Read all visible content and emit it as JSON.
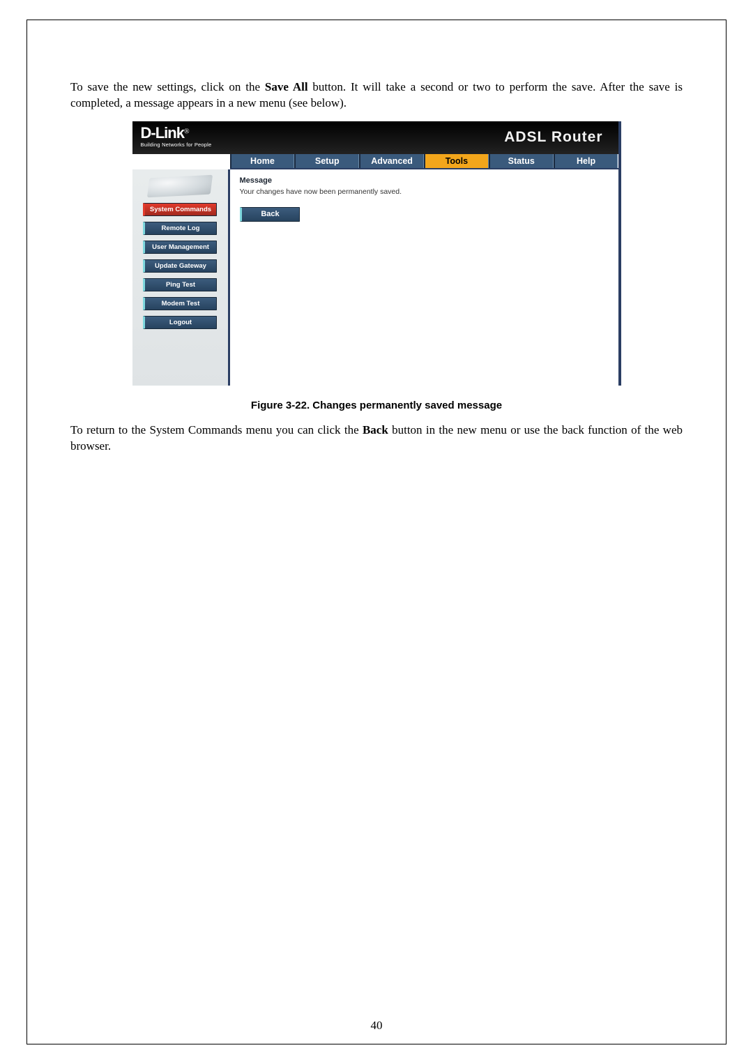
{
  "intro": {
    "pre": "To save the new settings, click on the ",
    "bold": "Save All",
    "post": " button. It will take a second or two to perform the save. After the save is completed, a message appears in a new menu (see below)."
  },
  "router": {
    "logo_main": "D-Link",
    "logo_dot": "®",
    "logo_sub": "Building Networks for People",
    "title": "ADSL Router",
    "tabs": [
      "Home",
      "Setup",
      "Advanced",
      "Tools",
      "Status",
      "Help"
    ],
    "active_tab_index": 3,
    "sidebar": [
      "System Commands",
      "Remote Log",
      "User Management",
      "Update Gateway",
      "Ping Test",
      "Modem Test",
      "Logout"
    ],
    "active_sidebar_index": 0,
    "message_label": "Message",
    "message_text": "Your changes have now been permanently saved.",
    "back_label": "Back"
  },
  "figure_caption": "Figure 3-22. Changes permanently saved message",
  "outro": {
    "pre": "To return to the System Commands menu you can click the ",
    "bold": "Back",
    "post": " button in the new menu or use the back function of the web browser."
  },
  "page_number": "40"
}
